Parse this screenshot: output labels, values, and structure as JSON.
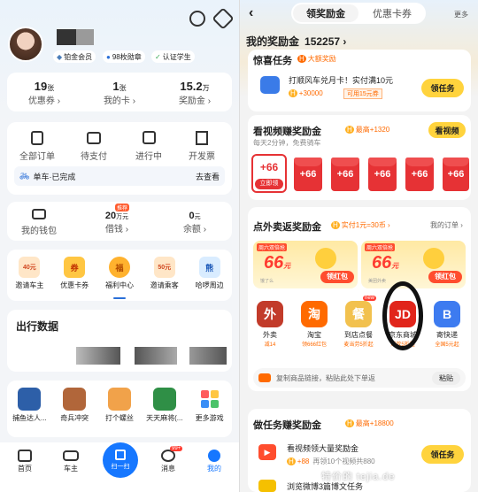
{
  "left": {
    "member": "铂金会员",
    "medal": "98枚勋章",
    "student": "认证学生",
    "stats": [
      {
        "value": "19",
        "unit": "张",
        "label": "优惠券 ›"
      },
      {
        "value": "1",
        "unit": "张",
        "label": "我的卡 ›"
      },
      {
        "value": "15.2",
        "unit": "万",
        "label": "奖励金 ›"
      }
    ],
    "orders": [
      "全部订单",
      "待支付",
      "进行中",
      "开发票"
    ],
    "bike": {
      "text": "单车·已完成",
      "action": "去查看"
    },
    "wallet": {
      "label": "我的钱包",
      "loan_value": "20",
      "loan_unit": "万元",
      "loan_badge": "推荐",
      "loan_label": "借钱 ›",
      "balance": "0",
      "balance_unit": "元",
      "balance_label": "余额 ›"
    },
    "services": [
      {
        "label": "邀请车主",
        "icon": "40元"
      },
      {
        "label": "优惠卡券",
        "icon": "券"
      },
      {
        "label": "福利中心",
        "icon": "福"
      },
      {
        "label": "邀请乘客",
        "icon": "50元"
      },
      {
        "label": "哈啰周边",
        "icon": "熊"
      }
    ],
    "travel_title": "出行数据",
    "games": [
      "捕鱼达人...",
      "奇兵冲突",
      "打个螺丝",
      "天天麻将(...",
      "更多游戏"
    ],
    "tabbar": {
      "home": "首页",
      "car": "车主",
      "scan": "扫一扫",
      "msg": "消息",
      "msg_badge": "99+",
      "me": "我的"
    }
  },
  "right": {
    "tabs": {
      "active": "领奖励金",
      "other": "优惠卡券",
      "more": "更多"
    },
    "balance": {
      "label": "我的奖励金",
      "value": "152257"
    },
    "surprise": {
      "title": "惊喜任务",
      "tag": "大额奖励",
      "item": "打顺风车兑月卡！实付满10元",
      "reward": "+30000",
      "extra": "可用15元券",
      "button": "领任务"
    },
    "video": {
      "title": "看视频赚奖励金",
      "max": "最高+1320",
      "sub": "每天2分钟，免费骑车",
      "button": "看视频",
      "envelopes": [
        "+66",
        "+66",
        "+66",
        "+66",
        "+66",
        "+66"
      ],
      "first_btn": "立即领"
    },
    "takeout": {
      "title": "点外卖返奖励金",
      "rate": "实付1元=30币 ›",
      "rules": "我的订单 ›",
      "coupon_tag": "周六双倍抢",
      "amount": "66",
      "unit": "元",
      "button": "领红包",
      "brand1": "饿了么",
      "brand2": "美团外卖",
      "apps": [
        {
          "name": "外卖",
          "sub": "减14"
        },
        {
          "name": "淘宝",
          "sub": "领666红包"
        },
        {
          "name": "到店点餐",
          "sub": "麦当劳5折起",
          "badge": "new"
        },
        {
          "name": "京东商城",
          "sub": "爆款5折起"
        },
        {
          "name": "寄快递",
          "sub": "全国5元起"
        }
      ],
      "paste_hint": "复制商品链接，粘贴此处下单返",
      "paste_btn": "粘贴"
    },
    "tasks": {
      "title": "做任务赚奖励金",
      "max": "最高+18800",
      "item1": "看视频领大量奖励金",
      "reward1": "+88",
      "sub1": "再领10个视频共880",
      "button1": "领任务",
      "item2": "浏览微博3篇博文任务"
    },
    "watermark": "特价的 tejia.de"
  },
  "colors": {
    "accent": "#1677ff",
    "yellow": "#ffd33d",
    "red": "#e63235",
    "orange": "#ff6a00"
  }
}
